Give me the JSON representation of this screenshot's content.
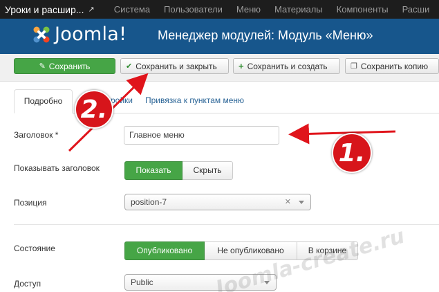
{
  "topnav": {
    "site": "Уроки и расшир...",
    "items": [
      "Система",
      "Пользователи",
      "Меню",
      "Материалы",
      "Компоненты",
      "Расши"
    ]
  },
  "header": {
    "logo": "Joomla!",
    "title": "Менеджер модулей: Модуль «Меню»"
  },
  "toolbar": {
    "save": "Сохранить",
    "save_close": "Сохранить и закрыть",
    "save_new": "Сохранить и создать",
    "save_copy": "Сохранить копию"
  },
  "tabs": {
    "details": "Подробно",
    "options": "ройки",
    "assignment": "Привязка к пунктам меню"
  },
  "form": {
    "title_label": "Заголовок *",
    "title_value": "Главное меню",
    "show_title_label": "Показывать заголовок",
    "show": "Показать",
    "hide": "Скрыть",
    "position_label": "Позиция",
    "position_value": "position-7",
    "state_label": "Состояние",
    "published": "Опубликовано",
    "unpublished": "Не опубликовано",
    "trashed": "В корзине",
    "access_label": "Доступ",
    "access_value": "Public"
  },
  "annotations": {
    "step1": "1.",
    "step2": "2.",
    "watermark": "Joomla-create.ru",
    "arrow_color": "#e0141b"
  },
  "colors": {
    "header_bg": "#17568c",
    "topbar_bg": "#1d1d1d",
    "active_green": "#46a546"
  }
}
